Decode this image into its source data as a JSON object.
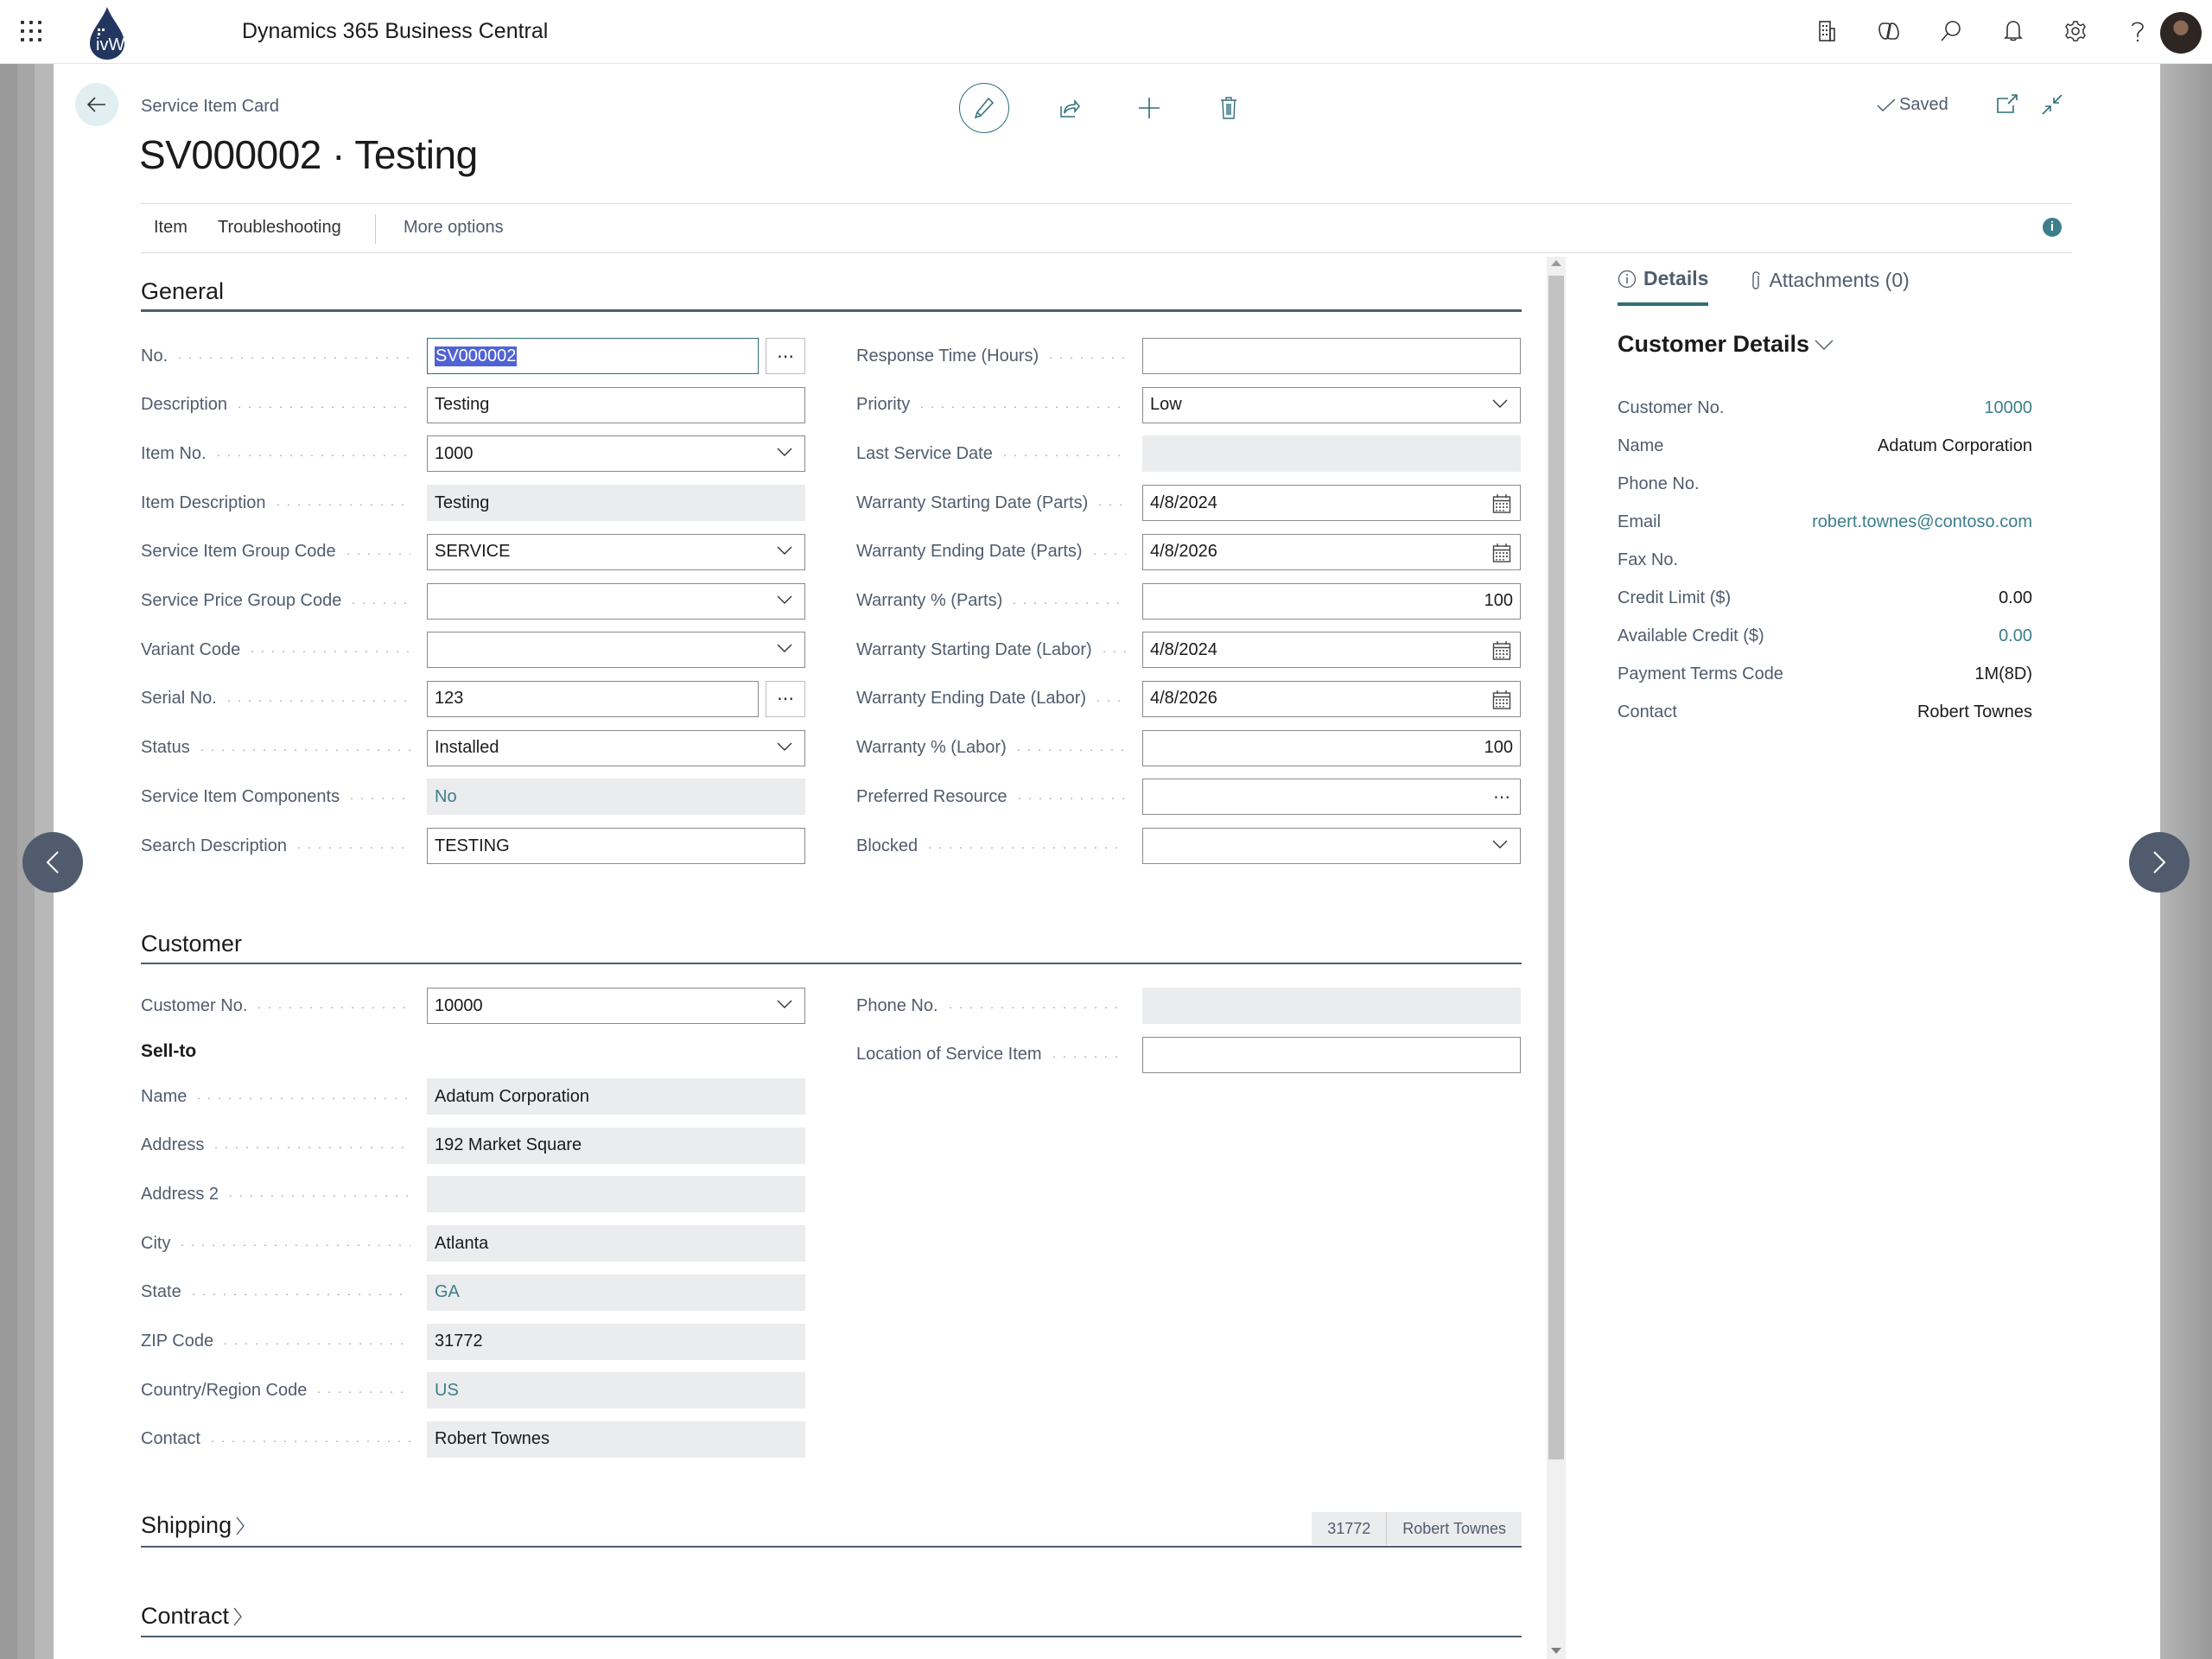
{
  "app": {
    "title": "Dynamics 365 Business Central",
    "logo_text": "ivWatch",
    "top_icons": [
      "environment-icon",
      "copilot-icon",
      "search-icon",
      "bell-icon",
      "gear-icon",
      "help-icon"
    ]
  },
  "header": {
    "breadcrumb": "Service Item Card",
    "title": "SV000002 · Testing",
    "saved_label": "Saved"
  },
  "actionbar": {
    "items": [
      "Item",
      "Troubleshooting",
      "More options"
    ]
  },
  "general": {
    "title": "General",
    "left": [
      {
        "label": "No.",
        "value": "SV000002",
        "kind": "text-assist",
        "selected": true
      },
      {
        "label": "Description",
        "value": "Testing",
        "kind": "text"
      },
      {
        "label": "Item No.",
        "value": "1000",
        "kind": "dropdown"
      },
      {
        "label": "Item Description",
        "value": "Testing",
        "kind": "readonly"
      },
      {
        "label": "Service Item Group Code",
        "value": "SERVICE",
        "kind": "dropdown"
      },
      {
        "label": "Service Price Group Code",
        "value": "",
        "kind": "dropdown"
      },
      {
        "label": "Variant Code",
        "value": "",
        "kind": "dropdown"
      },
      {
        "label": "Serial No.",
        "value": "123",
        "kind": "text-assist"
      },
      {
        "label": "Status",
        "value": "Installed",
        "kind": "dropdown"
      },
      {
        "label": "Service Item Components",
        "value": "No",
        "kind": "readonly-link"
      },
      {
        "label": "Search Description",
        "value": "TESTING",
        "kind": "text"
      }
    ],
    "right": [
      {
        "label": "Response Time (Hours)",
        "value": "",
        "kind": "text"
      },
      {
        "label": "Priority",
        "value": "Low",
        "kind": "dropdown"
      },
      {
        "label": "Last Service Date",
        "value": "",
        "kind": "readonly"
      },
      {
        "label": "Warranty Starting Date (Parts)",
        "value": "4/8/2024",
        "kind": "date"
      },
      {
        "label": "Warranty Ending Date (Parts)",
        "value": "4/8/2026",
        "kind": "date"
      },
      {
        "label": "Warranty % (Parts)",
        "value": "100",
        "kind": "number"
      },
      {
        "label": "Warranty Starting Date (Labor)",
        "value": "4/8/2024",
        "kind": "date"
      },
      {
        "label": "Warranty Ending Date (Labor)",
        "value": "4/8/2026",
        "kind": "date"
      },
      {
        "label": "Warranty % (Labor)",
        "value": "100",
        "kind": "number"
      },
      {
        "label": "Preferred Resource",
        "value": "",
        "kind": "lookup"
      },
      {
        "label": "Blocked",
        "value": "",
        "kind": "dropdown"
      }
    ]
  },
  "customer": {
    "title": "Customer",
    "customer_no": {
      "label": "Customer No.",
      "value": "10000"
    },
    "sell_to_label": "Sell-to",
    "sell_to": [
      {
        "label": "Name",
        "value": "Adatum Corporation",
        "kind": "readonly"
      },
      {
        "label": "Address",
        "value": "192 Market Square",
        "kind": "readonly"
      },
      {
        "label": "Address 2",
        "value": "",
        "kind": "readonly"
      },
      {
        "label": "City",
        "value": "Atlanta",
        "kind": "readonly"
      },
      {
        "label": "State",
        "value": "GA",
        "kind": "readonly-link"
      },
      {
        "label": "ZIP Code",
        "value": "31772",
        "kind": "readonly"
      },
      {
        "label": "Country/Region Code",
        "value": "US",
        "kind": "readonly-link"
      },
      {
        "label": "Contact",
        "value": "Robert Townes",
        "kind": "readonly"
      }
    ],
    "right": [
      {
        "label": "Phone No.",
        "value": "",
        "kind": "readonly"
      },
      {
        "label": "Location of Service Item",
        "value": "",
        "kind": "text"
      }
    ]
  },
  "shipping": {
    "title": "Shipping",
    "summary": [
      "31772",
      "Robert Townes"
    ]
  },
  "contract": {
    "title": "Contract"
  },
  "factbox": {
    "tabs": [
      {
        "label": "Details",
        "active": true
      },
      {
        "label": "Attachments (0)",
        "active": false
      }
    ],
    "title": "Customer Details",
    "rows": [
      {
        "label": "Customer No.",
        "value": "10000",
        "link": true
      },
      {
        "label": "Name",
        "value": "Adatum Corporation",
        "link": false
      },
      {
        "label": "Phone No.",
        "value": "",
        "link": false
      },
      {
        "label": "Email",
        "value": "robert.townes@contoso.com",
        "link": true
      },
      {
        "label": "Fax No.",
        "value": "",
        "link": false
      },
      {
        "label": "Credit Limit ($)",
        "value": "0.00",
        "link": false
      },
      {
        "label": "Available Credit ($)",
        "value": "0.00",
        "link": true
      },
      {
        "label": "Payment Terms Code",
        "value": "1M(8D)",
        "link": false
      },
      {
        "label": "Contact",
        "value": "Robert Townes",
        "link": false
      }
    ]
  },
  "colors": {
    "accent": "#2f6f78",
    "link": "#3c7e8a",
    "selection": "#5063d6",
    "nav_button": "#505c6d",
    "readonly_bg": "#ebecee"
  }
}
